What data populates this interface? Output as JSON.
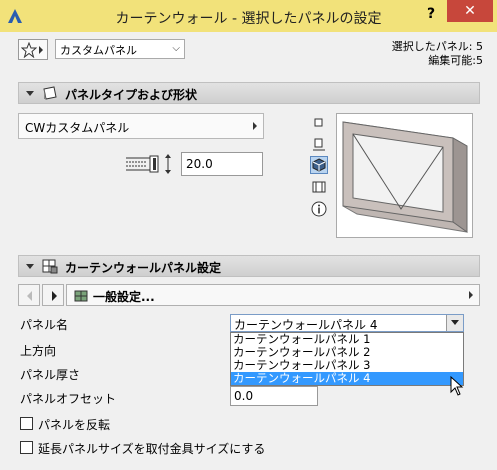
{
  "window": {
    "title": "カーテンウォール - 選択したパネルの設定",
    "help_label": "?",
    "close_label": "✕"
  },
  "header": {
    "preset_value": "カスタムパネル",
    "selected_panels": "選択したパネル: 5",
    "editable": "編集可能:5"
  },
  "section_type": {
    "title": "パネルタイプおよび形状",
    "type_value": "CWカスタムパネル",
    "thickness_value": "20.0",
    "view_icons": [
      "plan-view-icon",
      "section-view-icon",
      "3d-view-icon",
      "elevation-view-icon",
      "info-icon"
    ]
  },
  "section_settings": {
    "title": "カーテンウォールパネル設定",
    "page_label": "一般設定..."
  },
  "fields": {
    "panel_name_label": "パネル名",
    "direction_label": "上方向",
    "thickness_label": "パネル厚さ",
    "offset_label": "パネルオフセット",
    "panel_name_value": "カーテンウォールパネル 4",
    "offset_value": "0.0",
    "dropdown_options": [
      "カーテンウォールパネル 1",
      "カーテンウォールパネル 2",
      "カーテンウォールパネル 3",
      "カーテンウォールパネル 4"
    ],
    "selected_index": 3
  },
  "checkboxes": {
    "flip_label": "パネルを反転",
    "extend_label": "延長パネルサイズを取付金具サイズにする"
  },
  "colors": {
    "titlebar": "#f2e27a",
    "close": "#c7473b",
    "selection": "#3399ff"
  }
}
